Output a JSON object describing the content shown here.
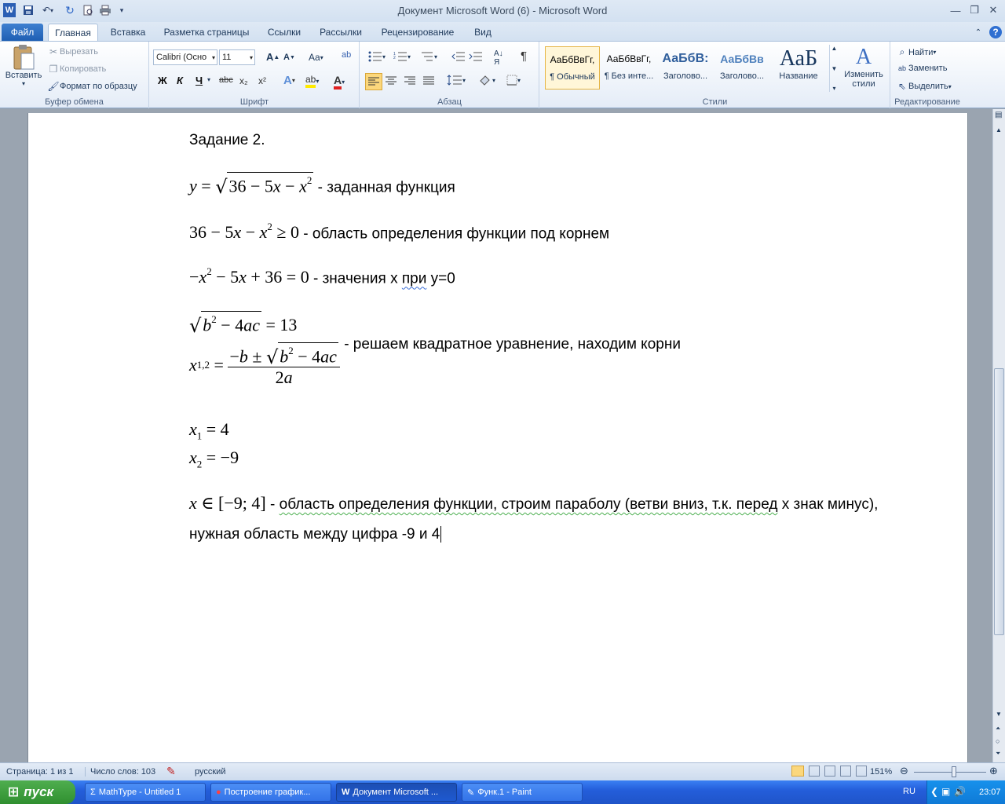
{
  "window": {
    "title": "Документ Microsoft Word (6)  -  Microsoft Word",
    "app_icon": "W"
  },
  "quick_access": {
    "save_icon": "save-icon",
    "undo_icon": "undo-icon",
    "redo_icon": "redo-icon",
    "print_preview_icon": "print-preview-icon",
    "print_icon": "print-icon"
  },
  "tabs": [
    "Файл",
    "Главная",
    "Вставка",
    "Разметка страницы",
    "Ссылки",
    "Рассылки",
    "Рецензирование",
    "Вид"
  ],
  "clipboard": {
    "paste": "Вставить",
    "cut": "Вырезать",
    "copy": "Копировать",
    "format_painter": "Формат по образцу",
    "group_label": "Буфер обмена"
  },
  "font": {
    "font_name": "Calibri (Осно",
    "font_size": "11",
    "group_label": "Шрифт",
    "bold": "Ж",
    "italic": "К",
    "underline": "Ч",
    "strike": "abc",
    "subscript": "x₂",
    "superscript": "x²",
    "change_case": "Aa"
  },
  "paragraph": {
    "group_label": "Абзац",
    "pilcrow": "¶"
  },
  "styles": {
    "group_label": "Стили",
    "items": [
      {
        "preview": "АаБбВвГг,",
        "name": "¶ Обычный"
      },
      {
        "preview": "АаБбВвГг,",
        "name": "¶ Без инте..."
      },
      {
        "preview": "АаБбВ:",
        "name": "Заголово..."
      },
      {
        "preview": "АаБбВв",
        "name": "Заголово..."
      },
      {
        "preview": "АаБ",
        "name": "Название"
      }
    ],
    "change_styles": "Изменить стили"
  },
  "editing": {
    "group_label": "Редактирование",
    "find": "Найти",
    "replace": "Заменить",
    "select": "Выделить"
  },
  "document": {
    "heading": "Задание 2.",
    "lines": [
      {
        "formula": "y = √(36 − 5x − x²)",
        "text": "- заданная функция"
      },
      {
        "formula": "36 − 5x − x² ≥ 0",
        "text": "- область определения функции под корнем"
      },
      {
        "formula": "−x² − 5x + 36 = 0",
        "text_a": "- значения x ",
        "text_b": "при",
        "text_c": " y=0"
      },
      {
        "formula": "√(b² − 4ac) = 13"
      },
      {
        "formula": "x₁,₂ = (−b ± √(b² − 4ac)) / 2a",
        "text": "- решаем квадратное уравнение, находим корни"
      },
      {
        "formula": "x₁ = 4"
      },
      {
        "formula": "x₂ = −9"
      },
      {
        "formula": "x ∈ [−9; 4]",
        "text_a": "- ",
        "text_b": "область определения функции, строим параболу (ветви вниз, т.к. перед",
        "text_c": " x знак минус),"
      }
    ],
    "last_line": "нужная область между цифра -9 и 4"
  },
  "status": {
    "page": "Страница: 1 из 1",
    "words": "Число слов: 103",
    "language": "русский",
    "zoom": "151%"
  },
  "taskbar": {
    "start": "пуск",
    "tasks": [
      "MathType - Untitled 1",
      "Построение график...",
      "Документ Microsoft ...",
      "Функ.1 - Paint"
    ],
    "lang": "RU",
    "clock": "23:07"
  }
}
